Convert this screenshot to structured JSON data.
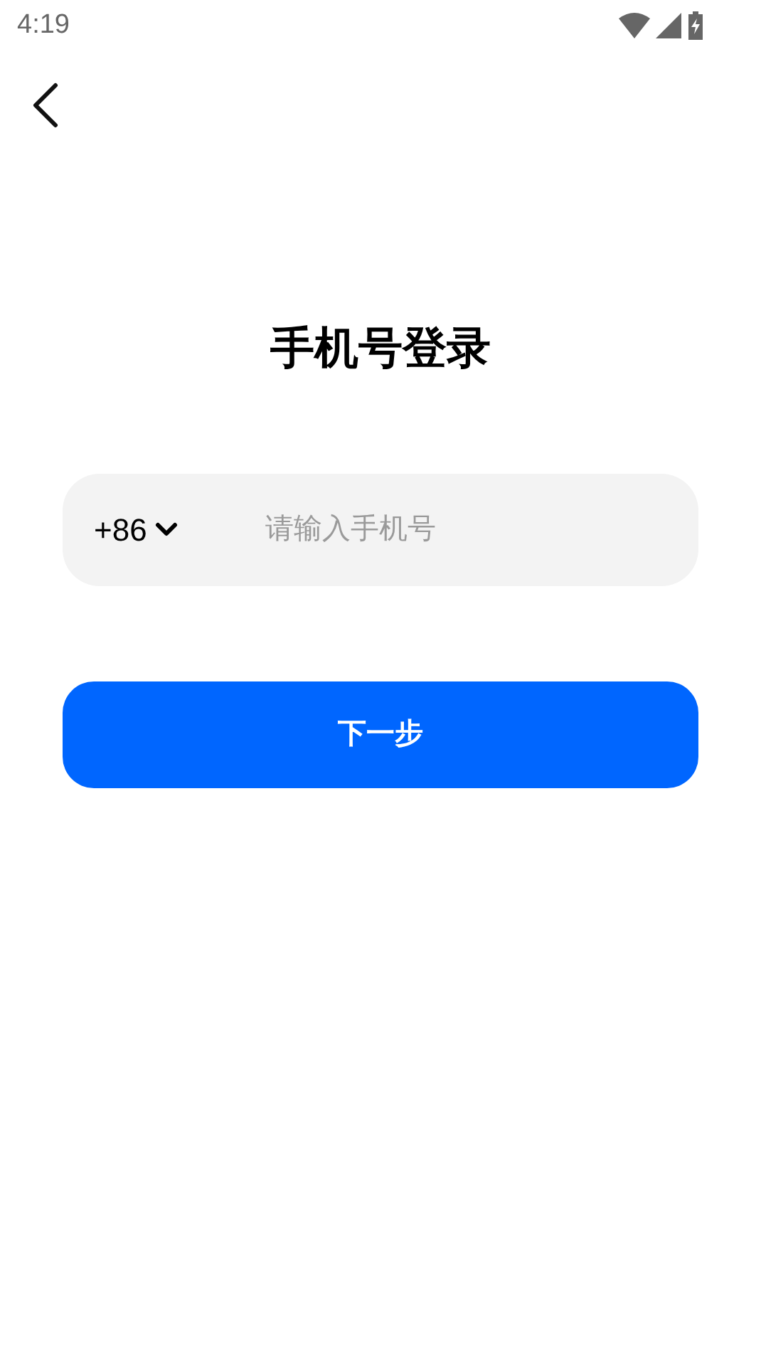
{
  "status_bar": {
    "time": "4:19"
  },
  "title": "手机号登录",
  "phone_field": {
    "country_code": "+86",
    "placeholder": "请输入手机号"
  },
  "next_button": {
    "label": "下一步"
  }
}
